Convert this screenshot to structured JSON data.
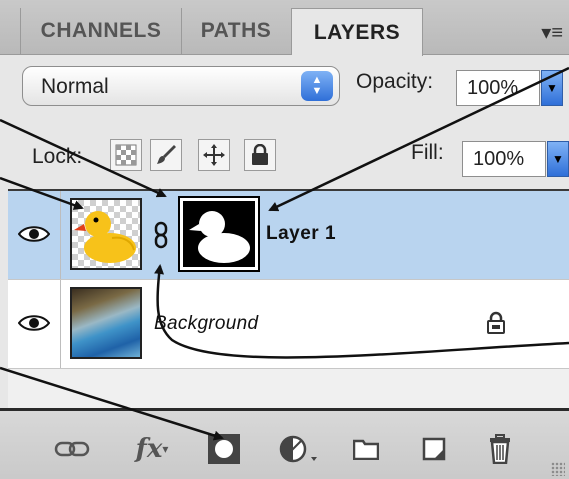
{
  "tabs": [
    {
      "label": "CHANNELS",
      "active": false
    },
    {
      "label": "PATHS",
      "active": false
    },
    {
      "label": "LAYERS",
      "active": true
    }
  ],
  "blend_mode": {
    "selected": "Normal"
  },
  "opacity": {
    "label": "Opacity:",
    "value": "100%"
  },
  "lock": {
    "label": "Lock:",
    "buttons": [
      {
        "icon": "lock-transparent-pixels-icon"
      },
      {
        "icon": "lock-image-pixels-brush-icon"
      },
      {
        "icon": "lock-position-move-icon"
      },
      {
        "icon": "lock-all-padlock-icon"
      }
    ]
  },
  "fill": {
    "label": "Fill:",
    "value": "100%"
  },
  "layers": [
    {
      "name": "Layer 1",
      "selected": true,
      "visible": true,
      "thumbnail": "rubber-duck",
      "has_mask": true,
      "linked": true
    },
    {
      "name": "Background",
      "selected": false,
      "visible": true,
      "thumbnail": "water-photo",
      "locked": true
    }
  ],
  "toolbar": {
    "buttons": [
      {
        "icon": "link-layers-icon"
      },
      {
        "icon": "fx-layer-style-icon",
        "label": "fx"
      },
      {
        "icon": "add-layer-mask-icon"
      },
      {
        "icon": "adjustment-layer-icon"
      },
      {
        "icon": "new-group-folder-icon"
      },
      {
        "icon": "new-layer-icon"
      },
      {
        "icon": "delete-layer-trash-icon"
      }
    ]
  },
  "colors": {
    "selected_row": "#b9d4ef",
    "panel_bg": "#e7e7e7",
    "accent_blue": "#2f6fd8"
  }
}
